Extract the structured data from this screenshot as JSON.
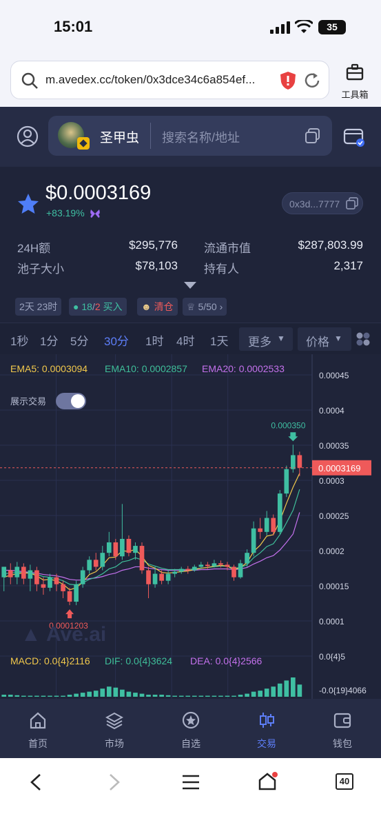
{
  "status": {
    "time": "15:01",
    "battery": "35"
  },
  "browser": {
    "url": "m.avedex.cc/token/0x3dce34c6a854ef...",
    "tools_label": "工具箱"
  },
  "header": {
    "token_name": "圣甲虫",
    "search_placeholder": "搜索名称/地址"
  },
  "token": {
    "price": "$0.0003169",
    "change": "+83.19%",
    "address": "0x3d...7777",
    "stats": [
      {
        "label": "24H额",
        "value": "$295,776"
      },
      {
        "label": "流通市值",
        "value": "$287,803.99"
      },
      {
        "label": "池子大小",
        "value": "$78,103"
      },
      {
        "label": "持有人",
        "value": "2,317"
      }
    ],
    "chips": {
      "age": "2天 23时",
      "buy_count": "18",
      "buy_total": "2",
      "buy_label": "买入",
      "clear": "清仓",
      "score": "5/50"
    }
  },
  "timeframes": [
    "1秒",
    "1分",
    "5分",
    "30分",
    "1时",
    "4时",
    "1天"
  ],
  "active_timeframe": "30分",
  "more_label": "更多",
  "price_label": "价格",
  "indicators": {
    "ema5": "EMA5: 0.0003094",
    "ema10": "EMA10: 0.0002857",
    "ema20": "EMA20: 0.0002533",
    "show_trades": "展示交易",
    "macd": "MACD: 0.0{4}2116",
    "dif": "DIF: 0.0{4}3624",
    "dea": "DEA: 0.0{4}2566",
    "watermark": "Ave.ai"
  },
  "colors": {
    "up": "#3fbfa2",
    "down": "#ef5a5a",
    "accent": "#5d7ef8",
    "ema5": "#f2c94c",
    "ema10": "#3fbf9a",
    "ema20": "#c471ed"
  },
  "chart_data": {
    "type": "candlestick",
    "price_axis": [
      "0.00045",
      "0.0004",
      "0.00035",
      "0.0003",
      "0.00025",
      "0.0002",
      "0.00015",
      "0.0001",
      "0.0{4}5"
    ],
    "macd_axis": "-0.0{19}4066",
    "current_price": "0.0003169",
    "high_label": "0.000350",
    "low_label": "0.0001203",
    "ylim": [
      5e-05,
      0.00045
    ],
    "candles": [
      [
        0.00016,
        0.000175,
        0.00015,
        0.00014
      ],
      [
        0.00017,
        0.00016,
        0.00018,
        0.00015
      ],
      [
        0.00016,
        0.000175,
        0.000182,
        0.00015
      ],
      [
        0.000175,
        0.000158,
        0.00018,
        0.00015
      ],
      [
        0.000158,
        0.00017,
        0.000178,
        0.00014
      ],
      [
        0.00017,
        0.00015,
        0.000175,
        0.00014
      ],
      [
        0.00015,
        0.000145,
        0.00016,
        0.000135
      ],
      [
        0.000145,
        0.00016,
        0.000165,
        0.00014
      ],
      [
        0.00016,
        0.00015,
        0.000165,
        0.00014
      ],
      [
        0.00015,
        0.00014,
        0.000155,
        0.00013
      ],
      [
        0.00014,
        0.000125,
        0.000145,
        0.00012
      ],
      [
        0.000125,
        0.00015,
        0.000155,
        0.00012
      ],
      [
        0.00015,
        0.00017,
        0.000175,
        0.000145
      ],
      [
        0.00017,
        0.000185,
        0.00019,
        0.000165
      ],
      [
        0.000185,
        0.000175,
        0.000195,
        0.00017
      ],
      [
        0.000175,
        0.000195,
        0.000205,
        0.00017
      ],
      [
        0.000195,
        0.00021,
        0.000225,
        0.00019
      ],
      [
        0.00021,
        0.00019,
        0.000215,
        0.000185
      ],
      [
        0.00019,
        0.000215,
        0.000265,
        0.000185
      ],
      [
        0.000215,
        0.000195,
        0.00022,
        0.00019
      ],
      [
        0.000195,
        0.000205,
        0.00021,
        0.000185
      ],
      [
        0.000205,
        0.00017,
        0.00021,
        0.000165
      ],
      [
        0.00017,
        0.00015,
        0.000175,
        0.00013
      ],
      [
        0.00015,
        0.000165,
        0.000175,
        0.000145
      ],
      [
        0.000165,
        0.000155,
        0.00017,
        0.00015
      ],
      [
        0.000155,
        0.000165,
        0.00017,
        0.00015
      ],
      [
        0.000165,
        0.000168,
        0.000172,
        0.00016
      ],
      [
        0.000168,
        0.000172,
        0.000175,
        0.000165
      ],
      [
        0.000172,
        0.00017,
        0.000176,
        0.000165
      ],
      [
        0.00017,
        0.000175,
        0.000178,
        0.000168
      ],
      [
        0.000175,
        0.000178,
        0.000182,
        0.000172
      ],
      [
        0.000178,
        0.000176,
        0.000182,
        0.000172
      ],
      [
        0.000176,
        0.00018,
        0.000185,
        0.000174
      ],
      [
        0.00018,
        0.000178,
        0.000184,
        0.000174
      ],
      [
        0.000178,
        0.000175,
        0.000182,
        0.00017
      ],
      [
        0.000175,
        0.00016,
        0.000178,
        0.000155
      ],
      [
        0.00016,
        0.00018,
        0.000185,
        0.000158
      ],
      [
        0.00018,
        0.000195,
        0.0002,
        0.000175
      ],
      [
        0.000195,
        0.00023,
        0.00024,
        0.00019
      ],
      [
        0.00023,
        0.000225,
        0.000245,
        0.000215
      ],
      [
        0.000225,
        0.000245,
        0.000255,
        0.00022
      ],
      [
        0.000245,
        0.000225,
        0.00025,
        0.00022
      ],
      [
        0.000225,
        0.00028,
        0.000285,
        0.000222
      ],
      [
        0.00028,
        0.000315,
        0.00032,
        0.000275
      ],
      [
        0.000315,
        0.000335,
        0.00035,
        0.00031
      ],
      [
        0.000335,
        0.000317,
        0.00034,
        0.000305
      ]
    ],
    "ema5": [
      0.00016,
      0.000163,
      0.000165,
      0.000166,
      0.000166,
      0.000162,
      0.000156,
      0.000157,
      0.000155,
      0.00015,
      0.000142,
      0.000145,
      0.000153,
      0.000164,
      0.000168,
      0.000177,
      0.000188,
      0.000189,
      0.000198,
      0.000197,
      0.0002,
      0.00019,
      0.000177,
      0.000173,
      0.000167,
      0.000166,
      0.000167,
      0.000168,
      0.000169,
      0.000171,
      0.000173,
      0.000174,
      0.000176,
      0.000177,
      0.000176,
      0.000171,
      0.000174,
      0.000181,
      0.000197,
      0.000206,
      0.000219,
      0.000221,
      0.000241,
      0.000266,
      0.000289,
      0.000309
    ],
    "ema10": [
      0.000165,
      0.000166,
      0.000167,
      0.000167,
      0.000166,
      0.000164,
      0.000161,
      0.00016,
      0.000158,
      0.000155,
      0.00015,
      0.000149,
      0.000152,
      0.000157,
      0.00016,
      0.000165,
      0.000172,
      0.000175,
      0.000182,
      0.000184,
      0.000188,
      0.000185,
      0.000179,
      0.000176,
      0.000173,
      0.000171,
      0.000171,
      0.000171,
      0.000171,
      0.000172,
      0.000173,
      0.000174,
      0.000175,
      0.000176,
      0.000176,
      0.000173,
      0.000174,
      0.000178,
      0.000188,
      0.000195,
      0.000204,
      0.000208,
      0.000221,
      0.000238,
      0.000256,
      0.000286
    ],
    "ema20": [
      0.00017,
      0.00017,
      0.000169,
      0.000168,
      0.000167,
      0.000166,
      0.000164,
      0.000163,
      0.000162,
      0.00016,
      0.000157,
      0.000156,
      0.000156,
      0.000158,
      0.000159,
      0.000161,
      0.000164,
      0.000166,
      0.00017,
      0.000172,
      0.000175,
      0.000175,
      0.000173,
      0.000172,
      0.000171,
      0.00017,
      0.00017,
      0.00017,
      0.00017,
      0.00017,
      0.000171,
      0.000171,
      0.000172,
      0.000172,
      0.000172,
      0.000171,
      0.000172,
      0.000174,
      0.000179,
      0.000183,
      0.000188,
      0.000191,
      0.000199,
      0.00021,
      0.000222,
      0.000253
    ],
    "volume": [
      0.2,
      0.2,
      0.15,
      0.1,
      0.1,
      0.1,
      0.1,
      0.1,
      0.1,
      0.1,
      0.2,
      0.3,
      0.4,
      0.5,
      0.6,
      0.8,
      1.0,
      0.9,
      0.7,
      0.5,
      0.4,
      0.3,
      0.2,
      0.2,
      0.2,
      0.15,
      0.1,
      0.1,
      0.1,
      0.1,
      0.1,
      0.1,
      0.1,
      0.1,
      0.1,
      0.1,
      0.2,
      0.3,
      0.5,
      0.6,
      0.8,
      1.0,
      1.3,
      1.6,
      1.9,
      1.2
    ]
  },
  "nav": [
    {
      "label": "首页",
      "icon": "home-icon"
    },
    {
      "label": "市场",
      "icon": "layers-icon"
    },
    {
      "label": "自选",
      "icon": "star-circle-icon"
    },
    {
      "label": "交易",
      "icon": "candles-icon"
    },
    {
      "label": "钱包",
      "icon": "wallet-icon"
    }
  ],
  "tabs_count": "40"
}
